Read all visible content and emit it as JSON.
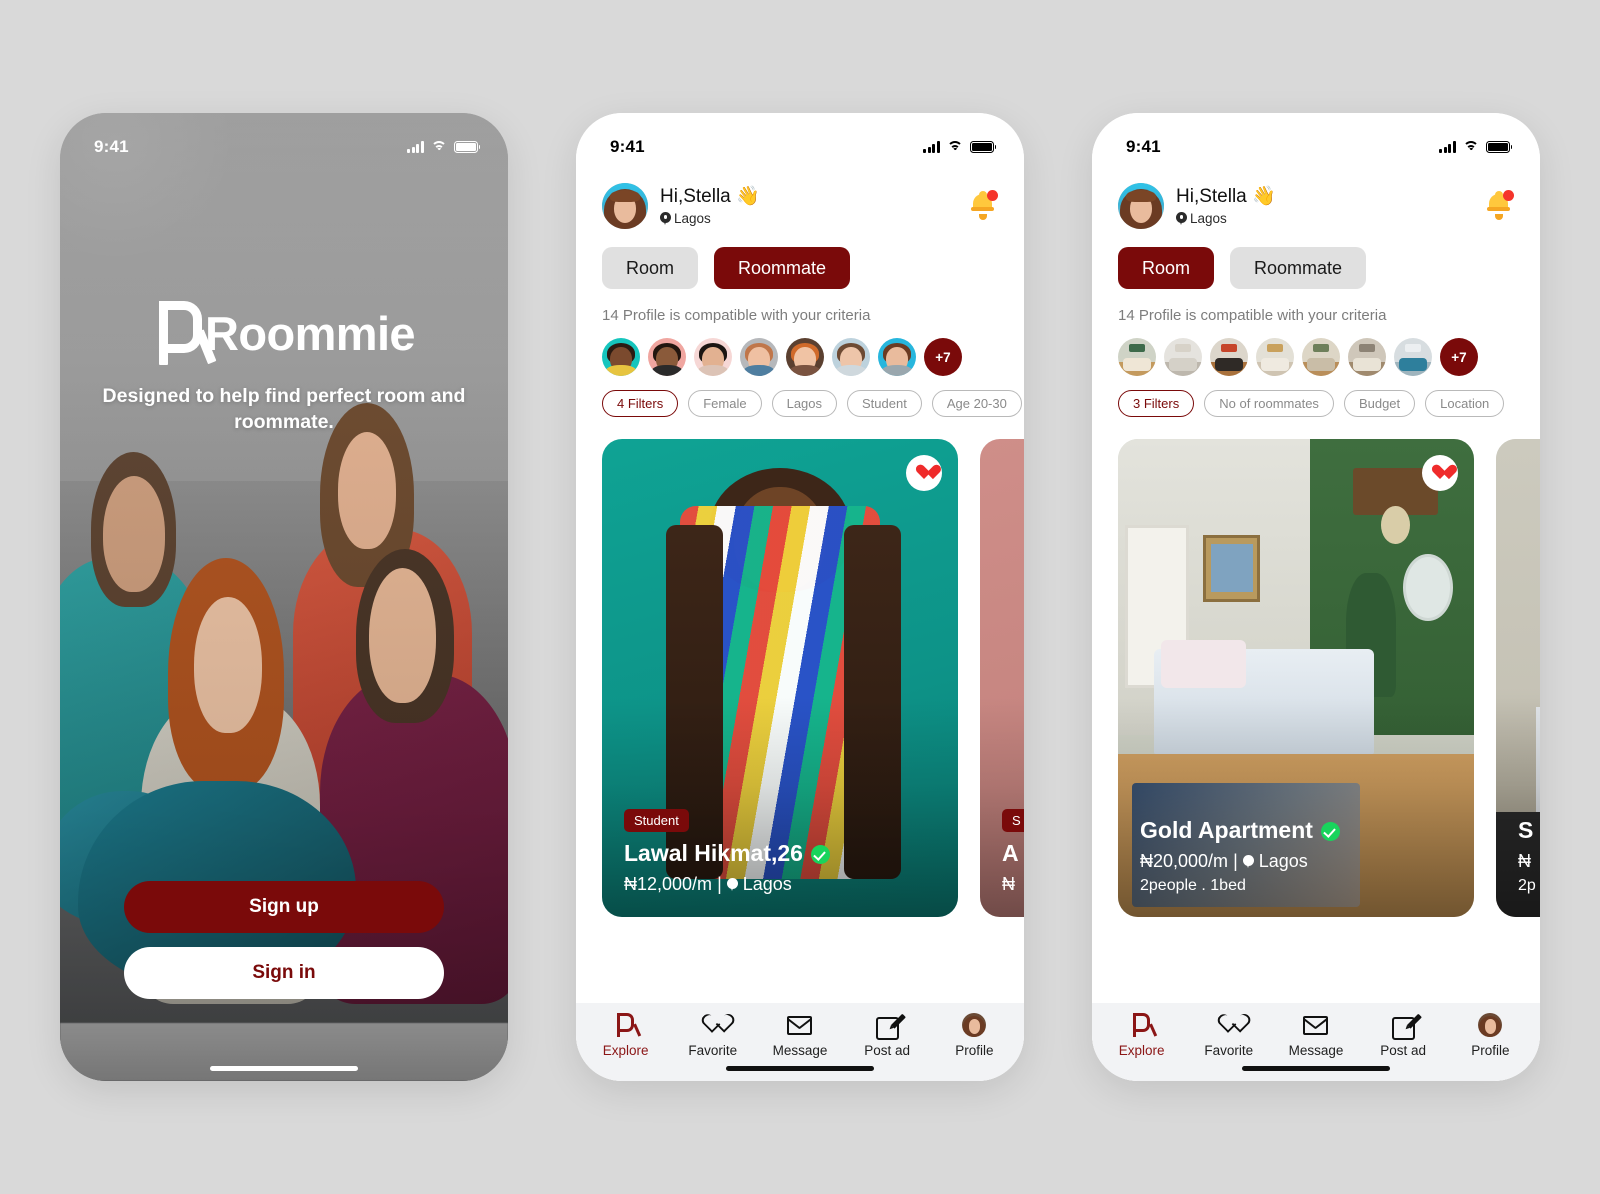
{
  "theme": {
    "brand": "#7A0A0A",
    "background": "#D9D9D9",
    "accent_green": "#18D45C",
    "heart_red": "#EF2B2B"
  },
  "screens": [
    {
      "id": "onboarding",
      "status_bar": {
        "time": "9:41"
      },
      "brand_name": "Roommie",
      "tagline": "Designed to help find perfect room and roommate.",
      "primary_button": "Sign up",
      "secondary_button": "Sign in"
    },
    {
      "id": "roommate-explore",
      "status_bar": {
        "time": "9:41"
      },
      "header": {
        "greeting": "Hi,Stella 👋",
        "location": "Lagos",
        "notification_badge": true
      },
      "segments": [
        {
          "label": "Room",
          "selected": false
        },
        {
          "label": "Roommate",
          "selected": true
        }
      ],
      "compat_text": "14 Profile is compatible with your criteria",
      "thumb_overflow": "+7",
      "thumb_count": 7,
      "filters": [
        {
          "label": "4 Filters",
          "active": true
        },
        {
          "label": "Female",
          "active": false
        },
        {
          "label": "Lagos",
          "active": false
        },
        {
          "label": "Student",
          "active": false
        },
        {
          "label": "Age 20-30",
          "active": false
        }
      ],
      "cards": [
        {
          "badge": "Student",
          "title": "Lawal Hikmat,26",
          "verified": true,
          "price": "₦12,000/m",
          "separator": "|",
          "location": "Lagos",
          "subtitle": "",
          "favorited": true
        },
        {
          "badge": "S",
          "title": "A",
          "verified": false,
          "price": "₦",
          "separator": "",
          "location": "",
          "subtitle": "",
          "favorited": false
        }
      ],
      "tabs": [
        {
          "label": "Explore",
          "icon": "roommie-r-icon",
          "active": true
        },
        {
          "label": "Favorite",
          "icon": "heart-outline-icon",
          "active": false
        },
        {
          "label": "Message",
          "icon": "envelope-icon",
          "active": false
        },
        {
          "label": "Post ad",
          "icon": "pencil-square-icon",
          "active": false
        },
        {
          "label": "Profile",
          "icon": "avatar-icon",
          "active": false
        }
      ]
    },
    {
      "id": "room-explore",
      "status_bar": {
        "time": "9:41"
      },
      "header": {
        "greeting": "Hi,Stella 👋",
        "location": "Lagos",
        "notification_badge": true
      },
      "segments": [
        {
          "label": "Room",
          "selected": true
        },
        {
          "label": "Roommate",
          "selected": false
        }
      ],
      "compat_text": "14 Profile is compatible with your criteria",
      "thumb_overflow": "+7",
      "thumb_count": 7,
      "filters": [
        {
          "label": "3 Filters",
          "active": true
        },
        {
          "label": "No of roommates",
          "active": false
        },
        {
          "label": "Budget",
          "active": false
        },
        {
          "label": "Location",
          "active": false
        }
      ],
      "cards": [
        {
          "badge": "",
          "title": "Gold Apartment",
          "verified": true,
          "price": "₦20,000/m",
          "separator": "|",
          "location": "Lagos",
          "subtitle": "2people . 1bed",
          "favorited": true
        },
        {
          "badge": "",
          "title": "S",
          "verified": false,
          "price": "₦",
          "separator": "",
          "location": "",
          "subtitle": "2p",
          "favorited": false
        }
      ],
      "tabs": [
        {
          "label": "Explore",
          "icon": "roommie-r-icon",
          "active": true
        },
        {
          "label": "Favorite",
          "icon": "heart-outline-icon",
          "active": false
        },
        {
          "label": "Message",
          "icon": "envelope-icon",
          "active": false
        },
        {
          "label": "Post ad",
          "icon": "pencil-square-icon",
          "active": false
        },
        {
          "label": "Profile",
          "icon": "avatar-icon",
          "active": false
        }
      ]
    }
  ]
}
